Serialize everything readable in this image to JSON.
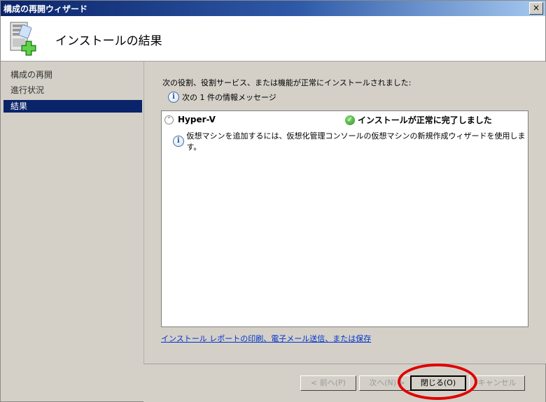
{
  "window": {
    "title": "構成の再開ウィザード",
    "close_label": "×"
  },
  "header": {
    "heading": "インストールの結果",
    "icon": "server-add-icon"
  },
  "nav": {
    "items": [
      {
        "label": "構成の再開",
        "active": false
      },
      {
        "label": "進行状況",
        "active": false
      },
      {
        "label": "結果",
        "active": true
      }
    ]
  },
  "content": {
    "summary": "次の役割、役割サービス、または機能が正常にインストールされました:",
    "info_count": "次の 1 件の情報メッセージ",
    "result": {
      "role": "Hyper-V",
      "status": "インストールが正常に完了しました",
      "message": "仮想マシンを追加するには、仮想化管理コンソールの仮想マシンの新規作成ウィザードを使用します。"
    },
    "report_link": "インストール レポートの印刷、電子メール送信、または保存"
  },
  "footer": {
    "back": "< 前へ(P)",
    "next": "次へ(N) >",
    "close": "閉じる(O)",
    "cancel": "キャンセル"
  },
  "colors": {
    "titlebar": "#0a246a",
    "nav_active": "#0a246a",
    "link": "#0033cc",
    "highlight": "#e00000"
  }
}
